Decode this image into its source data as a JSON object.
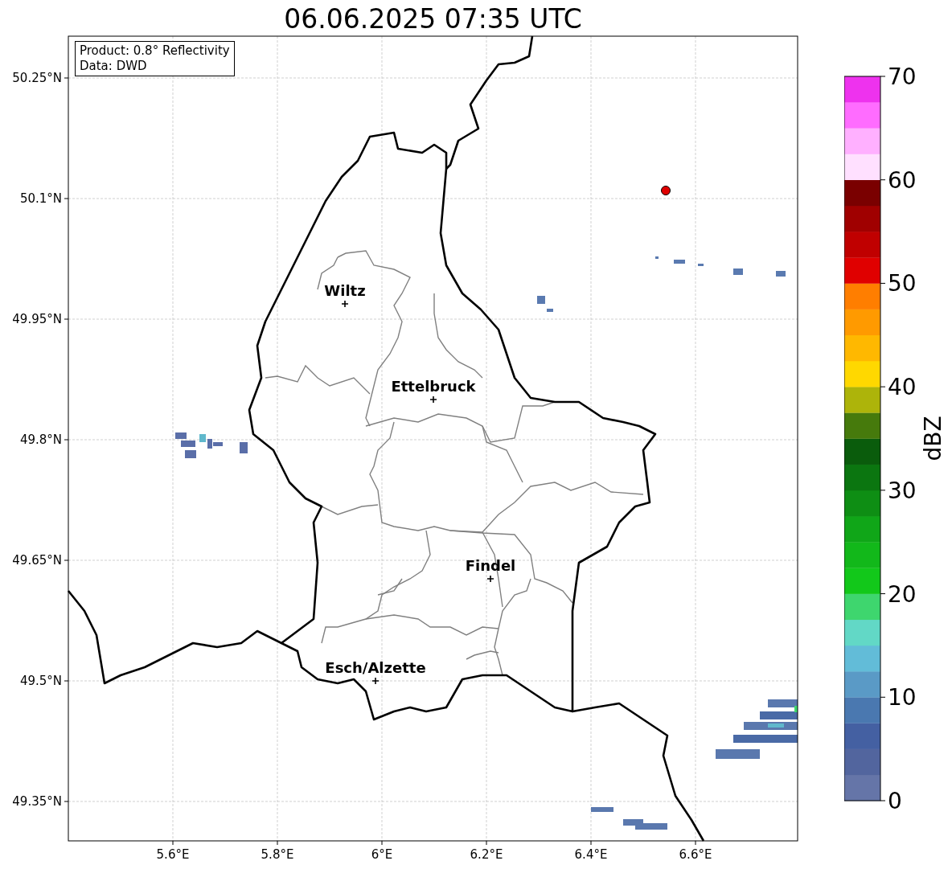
{
  "title": "06.06.2025 07:35 UTC",
  "map": {
    "info_box": [
      "Product: 0.8° Reflectivity",
      "Data: DWD"
    ],
    "x_ticks": [
      "5.6°E",
      "5.8°E",
      "6°E",
      "6.2°E",
      "6.4°E",
      "6.6°E"
    ],
    "y_ticks": [
      "50.25°N",
      "50.1°N",
      "49.95°N",
      "49.8°N",
      "49.65°N",
      "49.5°N",
      "49.35°N"
    ],
    "places": [
      {
        "name": "Wiltz"
      },
      {
        "name": "Ettelbruck"
      },
      {
        "name": "Findel"
      },
      {
        "name": "Esch/Alzette"
      }
    ]
  },
  "colorbar": {
    "label": "dBZ",
    "ticks": [
      "70",
      "60",
      "50",
      "40",
      "30",
      "20",
      "10",
      "0"
    ],
    "bins": [
      {
        "color": "#6575a8"
      },
      {
        "color": "#52659e"
      },
      {
        "color": "#4460a2"
      },
      {
        "color": "#4a78b0"
      },
      {
        "color": "#5a9ac6"
      },
      {
        "color": "#62bcd8"
      },
      {
        "color": "#62d8c6"
      },
      {
        "color": "#3ed66e"
      },
      {
        "color": "#12c81a"
      },
      {
        "color": "#12b81a"
      },
      {
        "color": "#10a618"
      },
      {
        "color": "#0e8e14"
      },
      {
        "color": "#0b7610"
      },
      {
        "color": "#0a5c0c"
      },
      {
        "color": "#467a0c"
      },
      {
        "color": "#adb40a"
      },
      {
        "color": "#ffd800"
      },
      {
        "color": "#ffb800"
      },
      {
        "color": "#ff9a00"
      },
      {
        "color": "#ff7e00"
      },
      {
        "color": "#e00000"
      },
      {
        "color": "#c00000"
      },
      {
        "color": "#a00000"
      },
      {
        "color": "#7a0000"
      },
      {
        "color": "#ffe0ff"
      },
      {
        "color": "#ffb0ff"
      },
      {
        "color": "#ff6cff"
      },
      {
        "color": "#ee32ee"
      }
    ]
  }
}
